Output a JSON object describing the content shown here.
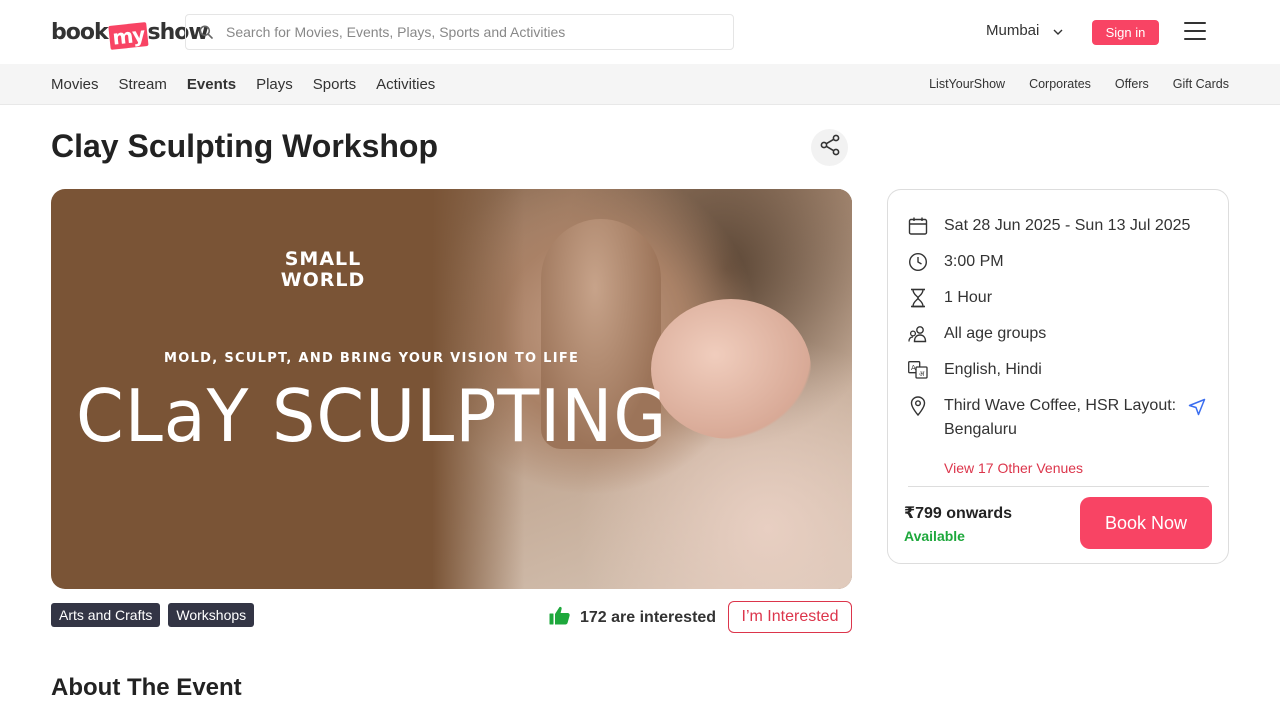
{
  "header": {
    "logo_left": "book",
    "logo_mid": "my",
    "logo_right": "show",
    "search_placeholder": "Search for Movies, Events, Plays, Sports and Activities",
    "city": "Mumbai",
    "signin_label": "Sign in"
  },
  "nav": {
    "left": [
      "Movies",
      "Stream",
      "Events",
      "Plays",
      "Sports",
      "Activities"
    ],
    "active": "Events",
    "right": [
      "ListYourShow",
      "Corporates",
      "Offers",
      "Gift Cards"
    ]
  },
  "event": {
    "title": "Clay Sculpting Workshop",
    "banner_brand_line1": "SMALL",
    "banner_brand_line2": "WORLD",
    "banner_tagline": "MOLD, SCULPT, AND BRING YOUR VISION TO LIFE",
    "banner_title": "CLaY SCULPTING",
    "tags": [
      "Arts and Crafts",
      "Workshops"
    ],
    "interested_count": "172 are interested",
    "interested_button": "I’m Interested"
  },
  "details": {
    "date": "Sat 28 Jun 2025 - Sun 13 Jul 2025",
    "time": "3:00 PM",
    "duration": "1 Hour",
    "age": "All age groups",
    "language": "English, Hindi",
    "venue_line1": "Third Wave Coffee, HSR Layout:",
    "venue_line2": "Bengaluru",
    "other_venues": "View 17 Other Venues",
    "price": "₹799 onwards",
    "availability": "Available",
    "book_label": "Book Now"
  },
  "about_heading": "About The Event",
  "colors": {
    "brand": "#f84464",
    "tag_bg": "#333545",
    "available": "#1ea83c"
  }
}
